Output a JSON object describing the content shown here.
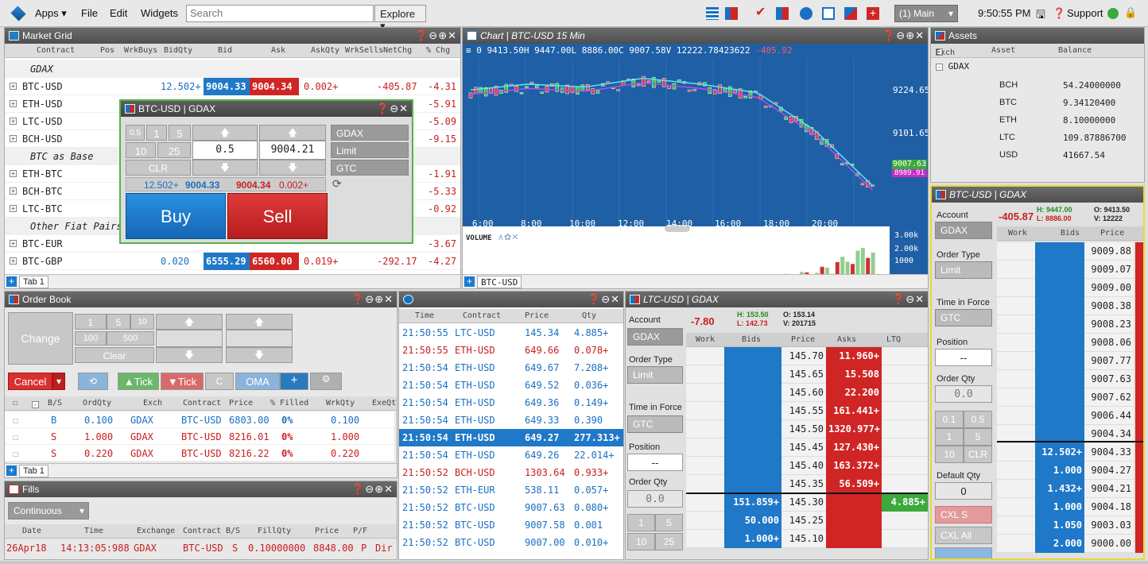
{
  "topbar": {
    "apps": "Apps ▾",
    "file": "File",
    "edit": "Edit",
    "widgets": "Widgets",
    "search_placeholder": "Search",
    "explore": "Explore ▾",
    "workspace": "(1) Main",
    "time": "9:50:55 PM",
    "support": "Support"
  },
  "market_grid": {
    "title": "Market Grid",
    "headers": [
      "Contract",
      "Pos",
      "WrkBuys",
      "BidQty",
      "Bid",
      "Ask",
      "AskQty",
      "WrkSells",
      "NetChg",
      "% Chg"
    ],
    "rows": [
      {
        "type": "group",
        "label": "GDAX"
      },
      {
        "type": "row",
        "contract": "BTC-USD",
        "bidqty": "12.502+",
        "bid": "9004.33",
        "ask": "9004.34",
        "askqty": "0.002+",
        "netchg": "-405.87",
        "pct": "-4.31"
      },
      {
        "type": "row",
        "contract": "ETH-USD",
        "pct": "-5.91"
      },
      {
        "type": "row",
        "contract": "LTC-USD",
        "pct": "-5.09"
      },
      {
        "type": "row",
        "contract": "BCH-USD",
        "pct": "-9.15"
      },
      {
        "type": "group",
        "label": "BTC as Base"
      },
      {
        "type": "row",
        "contract": "ETH-BTC",
        "pct": "-1.91"
      },
      {
        "type": "row",
        "contract": "BCH-BTC",
        "pct": "-5.33"
      },
      {
        "type": "row",
        "contract": "LTC-BTC",
        "pct": "-0.92"
      },
      {
        "type": "group",
        "label": "Other Fiat Pairs"
      },
      {
        "type": "row",
        "contract": "BTC-EUR",
        "pct": "-3.67"
      },
      {
        "type": "row",
        "contract": "BTC-GBP",
        "bidqty": "0.020",
        "bid": "6555.29",
        "ask": "6560.00",
        "askqty": "0.019+",
        "netchg": "-292.17",
        "pct": "-4.27"
      }
    ],
    "tab": "Tab 1"
  },
  "order_ticket": {
    "title": "BTC-USD | GDAX",
    "qty_presets": [
      "0.5",
      "1",
      "5",
      "10",
      "25"
    ],
    "clr": "CLR",
    "qty": "0.5",
    "price": "9004.21",
    "exchange": "GDAX",
    "order_type": "Limit",
    "tif": "GTC",
    "bidqty": "12.502+",
    "bid": "9004.33",
    "ask": "9004.34",
    "askqty": "0.002+",
    "buy": "Buy",
    "sell": "Sell"
  },
  "chart": {
    "title": "Chart | BTC-USD 15 Min",
    "ohlc": "0 9413.50H 9447.00L 8886.00C 9007.58V 12222.78423622",
    "ohlc_change": "-405.92",
    "price_ticks": [
      "9224.65",
      "9101.65"
    ],
    "last_price": "9007.63",
    "last_price2": "8989.91",
    "time_ticks": [
      "6:00",
      "8:00",
      "10:00",
      "12:00",
      "14:00",
      "16:00",
      "18:00",
      "20:00"
    ],
    "volume_label": "VOLUME",
    "volume_ticks": [
      "3.00k",
      "2.00k",
      "1000"
    ],
    "tab": "BTC-USD"
  },
  "chart_data": {
    "type": "line",
    "title": "Chart | BTC-USD 15 Min",
    "x": [
      "6:00",
      "8:00",
      "10:00",
      "12:00",
      "14:00",
      "16:00",
      "18:00",
      "20:00"
    ],
    "series": [
      {
        "name": "",
        "values": [
          9340,
          9360,
          9350,
          9380,
          9360,
          9330,
          9200,
          9010
        ]
      },
      {
        "name": "VOLUME",
        "values": [
          200,
          250,
          300,
          350,
          300,
          600,
          900,
          2200
        ]
      }
    ],
    "ylim": [
      8880,
      9460
    ],
    "grid": true
  },
  "assets": {
    "title": "Assets",
    "headers": [
      "Exch",
      "Asset",
      "Balance"
    ],
    "group": "GDAX",
    "rows": [
      {
        "asset": "BCH",
        "balance": "54.24000000"
      },
      {
        "asset": "BTC",
        "balance": "9.34120400"
      },
      {
        "asset": "ETH",
        "balance": "8.10000000"
      },
      {
        "asset": "LTC",
        "balance": "109.87886700"
      },
      {
        "asset": "USD",
        "balance": "41667.54"
      }
    ]
  },
  "ladder_btc": {
    "title": "BTC-USD | GDAX",
    "account_label": "Account",
    "netchg": "-405.87",
    "high": "H: 9447.00",
    "low": "L: 8886.00",
    "open": "O: 9413.50",
    "vol": "V: 12222",
    "exchange": "GDAX",
    "order_type_label": "Order Type",
    "order_type": "Limit",
    "tif_label": "Time in Force",
    "tif": "GTC",
    "position_label": "Position",
    "position": "--",
    "order_qty_label": "Order Qty",
    "order_qty": "0.0",
    "default_qty_label": "Default Qty",
    "default_qty": "0",
    "cxl_s": "CXL S",
    "cxl_all": "CXL All",
    "headers": [
      "Work",
      "Bids",
      "Price"
    ],
    "presets": [
      "0.1",
      "0.5",
      "1",
      "5",
      "10",
      "CLR"
    ],
    "prices": [
      "9009.88",
      "9009.07",
      "9009.00",
      "9008.38",
      "9008.23",
      "9008.06",
      "9007.77",
      "9007.63",
      "9007.62",
      "9006.44",
      "9004.34",
      "9004.33",
      "9004.27",
      "9004.21",
      "9004.18",
      "9003.03",
      "9000.00"
    ],
    "bids": [
      "",
      "",
      "",
      "",
      "",
      "",
      "",
      "",
      "",
      "",
      "",
      "12.502+",
      "1.000",
      "1.432+",
      "1.000",
      "1.050",
      "2.000"
    ]
  },
  "order_book": {
    "title": "Order Book",
    "change": "Change",
    "presets": [
      "1",
      "5",
      "10",
      "100",
      "500"
    ],
    "clear": "Clear",
    "cancel": "Cancel",
    "tick_up": "Tick",
    "tick_down": "Tick",
    "oma": "OMA",
    "headers": [
      "B/S",
      "OrdQty",
      "Exch",
      "Contract",
      "Price",
      "% Filled",
      "WrkQty",
      "ExeQty"
    ],
    "rows": [
      {
        "bs": "B",
        "qty": "0.100",
        "exch": "GDAX",
        "contract": "BTC-USD",
        "price": "6803.00",
        "filled": "0%",
        "wrk": "0.100"
      },
      {
        "bs": "S",
        "qty": "1.000",
        "exch": "GDAX",
        "contract": "BTC-USD",
        "price": "8216.01",
        "filled": "0%",
        "wrk": "1.000"
      },
      {
        "bs": "S",
        "qty": "0.220",
        "exch": "GDAX",
        "contract": "BTC-USD",
        "price": "8216.22",
        "filled": "0%",
        "wrk": "0.220"
      }
    ],
    "tab": "Tab 1"
  },
  "fills": {
    "title": "Fills",
    "mode": "Continuous",
    "headers": [
      "Date",
      "Time",
      "Exchange",
      "Contract",
      "B/S",
      "FillQty",
      "Price",
      "P/F"
    ],
    "rows": [
      {
        "date": "26Apr18",
        "time": "14:13:05:988",
        "exch": "GDAX",
        "contract": "BTC-USD",
        "bs": "S",
        "qty": "0.10000000",
        "price": "8848.00",
        "pf": "P",
        "extra": "Dir"
      }
    ]
  },
  "tas": {
    "headers": [
      "Time",
      "Contract",
      "Price",
      "Qty"
    ],
    "rows": [
      {
        "t": "21:50:55",
        "c": "LTC-USD",
        "p": "145.34",
        "q": "4.885+",
        "side": "buy"
      },
      {
        "t": "21:50:55",
        "c": "ETH-USD",
        "p": "649.66",
        "q": "0.078+",
        "side": "sell"
      },
      {
        "t": "21:50:54",
        "c": "ETH-USD",
        "p": "649.67",
        "q": "7.208+",
        "side": "buy"
      },
      {
        "t": "21:50:54",
        "c": "ETH-USD",
        "p": "649.52",
        "q": "0.036+",
        "side": "buy"
      },
      {
        "t": "21:50:54",
        "c": "ETH-USD",
        "p": "649.36",
        "q": "0.149+",
        "side": "buy"
      },
      {
        "t": "21:50:54",
        "c": "ETH-USD",
        "p": "649.33",
        "q": "0.390",
        "side": "buy"
      },
      {
        "t": "21:50:54",
        "c": "ETH-USD",
        "p": "649.27",
        "q": "277.313+",
        "side": "hl"
      },
      {
        "t": "21:50:54",
        "c": "ETH-USD",
        "p": "649.26",
        "q": "22.014+",
        "side": "buy"
      },
      {
        "t": "21:50:52",
        "c": "BCH-USD",
        "p": "1303.64",
        "q": "0.933+",
        "side": "sell"
      },
      {
        "t": "21:50:52",
        "c": "ETH-EUR",
        "p": "538.11",
        "q": "0.057+",
        "side": "buy"
      },
      {
        "t": "21:50:52",
        "c": "BTC-USD",
        "p": "9007.63",
        "q": "0.080+",
        "side": "buy"
      },
      {
        "t": "21:50:52",
        "c": "BTC-USD",
        "p": "9007.58",
        "q": "0.001",
        "side": "buy"
      },
      {
        "t": "21:50:52",
        "c": "BTC-USD",
        "p": "9007.00",
        "q": "0.010+",
        "side": "buy"
      }
    ]
  },
  "ladder_ltc": {
    "title": "LTC-USD | GDAX",
    "account_label": "Account",
    "netchg": "-7.80",
    "high": "H: 153.50",
    "low": "L: 142.73",
    "open": "O: 153.14",
    "vol": "V: 201715",
    "exchange": "GDAX",
    "order_type_label": "Order Type",
    "order_type": "Limit",
    "tif_label": "Time in Force",
    "tif": "GTC",
    "position_label": "Position",
    "position": "--",
    "order_qty_label": "Order Qty",
    "order_qty": "0.0",
    "headers": [
      "Work",
      "Bids",
      "Price",
      "Asks",
      "LTQ"
    ],
    "presets": [
      "1",
      "5",
      "10",
      "25"
    ],
    "prices": [
      "145.70",
      "145.65",
      "145.60",
      "145.55",
      "145.50",
      "145.45",
      "145.40",
      "145.35",
      "145.30",
      "145.25",
      "145.10"
    ],
    "asks": [
      "11.960+",
      "15.508",
      "22.200",
      "161.441+",
      "1320.977+",
      "127.430+",
      "163.372+",
      "56.509+",
      "",
      "",
      ""
    ],
    "bids": [
      "",
      "",
      "",
      "",
      "",
      "",
      "",
      "",
      "151.859+",
      "50.000",
      "1.000+"
    ],
    "ltq": "4.885+"
  }
}
